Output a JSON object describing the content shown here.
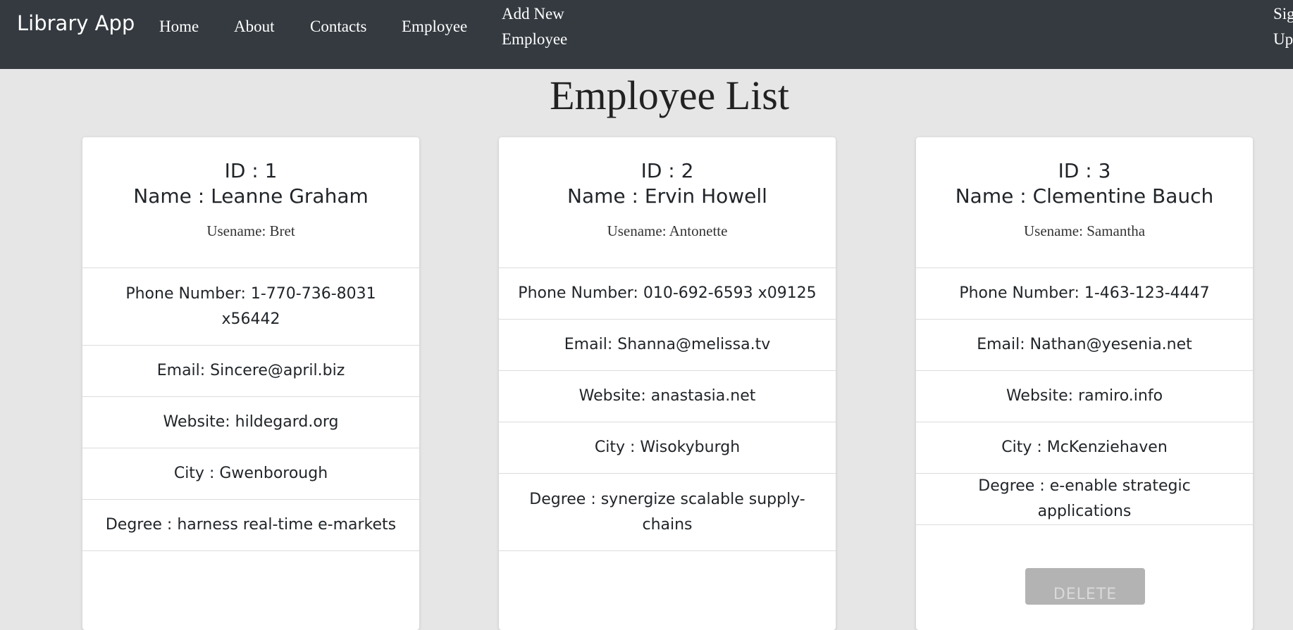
{
  "navbar": {
    "brand": "Library App",
    "links": [
      "Home",
      "About",
      "Contacts",
      "Employee"
    ],
    "add_new_line1": "Add New",
    "add_new_line2": "Employee",
    "signup_line1": "Sig",
    "signup_line2": "Up"
  },
  "page": {
    "title": "Employee List"
  },
  "employees": [
    {
      "id": "ID : 1",
      "name": "Name : Leanne Graham",
      "username": "Usename: Bret",
      "phone_line1": "Phone Number: 1-770-736-8031",
      "phone_line2": "x56442",
      "email": "Email: Sincere@april.biz",
      "website": "Website: hildegard.org",
      "city": "City : Gwenborough",
      "degree": "Degree : harness real-time e-markets"
    },
    {
      "id": "ID : 2",
      "name": "Name : Ervin Howell",
      "username": "Usename: Antonette",
      "phone": "Phone Number: 010-692-6593 x09125",
      "email": "Email: Shanna@melissa.tv",
      "website": "Website: anastasia.net",
      "city": "City : Wisokyburgh",
      "degree_line1": "Degree : synergize scalable supply-",
      "degree_line2": "chains"
    },
    {
      "id": "ID : 3",
      "name": "Name : Clementine Bauch",
      "username": "Usename: Samantha",
      "phone": "Phone Number: 1-463-123-4447",
      "email": "Email: Nathan@yesenia.net",
      "website": "Website: ramiro.info",
      "city": "City : McKenziehaven",
      "degree": "Degree : e-enable strategic applications",
      "delete_label": "DELETE"
    }
  ],
  "colors": {
    "navbar": "#343a40",
    "background": "#e6e6e6",
    "card": "#ffffff",
    "delete_button": "#b3b3b3"
  }
}
